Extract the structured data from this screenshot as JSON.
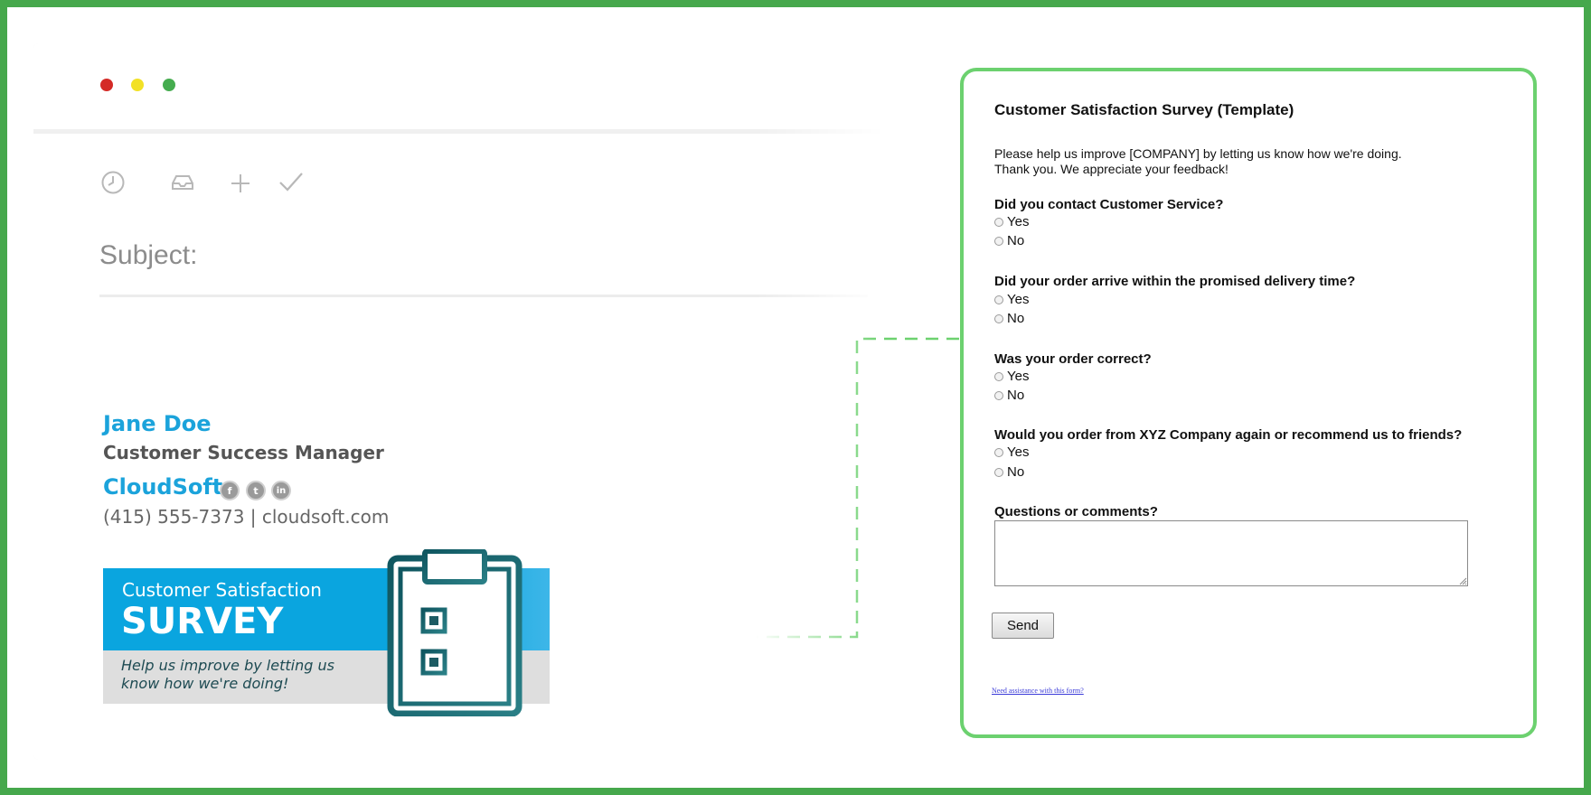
{
  "email": {
    "subject_label": "Subject:",
    "toolbar_icons": [
      "clock-icon",
      "inbox-icon",
      "plus-icon",
      "check-icon"
    ],
    "signature": {
      "name": "Jane Doe",
      "title": "Customer Success Manager",
      "company": "CloudSoft",
      "contact": "(415) 555-7373 | cloudsoft.com",
      "social": [
        {
          "icon": "facebook-icon",
          "glyph": "f"
        },
        {
          "icon": "twitter-icon",
          "glyph": "t"
        },
        {
          "icon": "linkedin-icon",
          "glyph": "in"
        }
      ]
    },
    "banner": {
      "kicker": "Customer Satisfaction",
      "headline": "SURVEY",
      "tagline": "Help us improve by letting us know how we're doing!",
      "icon": "clipboard-checklist-icon"
    }
  },
  "survey": {
    "title": "Customer Satisfaction Survey (Template)",
    "intro_line1": "Please help us improve [COMPANY] by letting us know how we're doing.",
    "intro_line2": "Thank you. We appreciate your feedback!",
    "questions": [
      {
        "label": "Did you contact Customer Service?",
        "options": [
          "Yes",
          "No"
        ]
      },
      {
        "label": "Did your order arrive within the promised delivery time?",
        "options": [
          "Yes",
          "No"
        ]
      },
      {
        "label": "Was your order correct?",
        "options": [
          "Yes",
          "No"
        ]
      },
      {
        "label": "Would you order from XYZ Company again or recommend us to friends?",
        "options": [
          "Yes",
          "No"
        ]
      }
    ],
    "comments_label": "Questions or comments?",
    "comments_value": "",
    "send_label": "Send",
    "help_link": "Need assistance with this form?"
  },
  "colors": {
    "frame_green": "#46a84c",
    "panel_green": "#6cd16f",
    "brand_blue": "#1ba3db",
    "teal": "#1d5b63"
  }
}
